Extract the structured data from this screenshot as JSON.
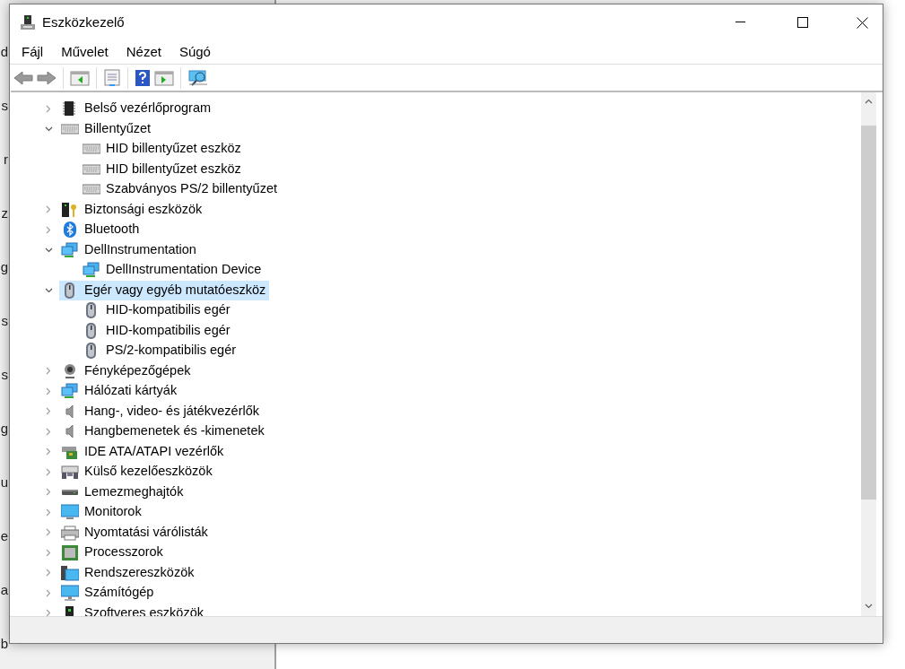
{
  "background_window": {
    "fragments": [
      "d",
      "s",
      "r",
      "z",
      "g",
      "s",
      "s",
      "g",
      "u",
      "e",
      "a",
      "b"
    ]
  },
  "window": {
    "title": "Eszközkezelő"
  },
  "menu": [
    "Fájl",
    "Művelet",
    "Nézet",
    "Súgó"
  ],
  "tree": [
    {
      "label": "Belső vezérlőprogram",
      "kind": "chip",
      "expanded": false,
      "selected": false
    },
    {
      "label": "Billentyűzet",
      "kind": "keyboard",
      "expanded": true,
      "selected": false,
      "children": [
        {
          "label": "HID billentyűzet eszköz",
          "kind": "keyboard",
          "selected": false
        },
        {
          "label": "HID billentyűzet eszköz",
          "kind": "keyboard",
          "selected": false
        },
        {
          "label": "Szabványos PS/2 billentyűzet",
          "kind": "keyboard",
          "selected": false
        }
      ]
    },
    {
      "label": "Biztonsági eszközök",
      "kind": "security",
      "expanded": false,
      "selected": false
    },
    {
      "label": "Bluetooth",
      "kind": "bluetooth",
      "expanded": false,
      "selected": false
    },
    {
      "label": "DellInstrumentation",
      "kind": "network",
      "expanded": true,
      "selected": false,
      "children": [
        {
          "label": "DellInstrumentation Device",
          "kind": "network",
          "selected": false
        }
      ]
    },
    {
      "label": "Egér vagy egyéb mutatóeszköz",
      "kind": "mouse",
      "expanded": true,
      "selected": true,
      "children": [
        {
          "label": "HID-kompatibilis egér",
          "kind": "mouse",
          "selected": false
        },
        {
          "label": "HID-kompatibilis egér",
          "kind": "mouse",
          "selected": false
        },
        {
          "label": "PS/2-kompatibilis egér",
          "kind": "mouse",
          "selected": false
        }
      ]
    },
    {
      "label": "Fényképezőgépek",
      "kind": "camera",
      "expanded": false,
      "selected": false
    },
    {
      "label": "Hálózati kártyák",
      "kind": "network",
      "expanded": false,
      "selected": false
    },
    {
      "label": "Hang-, video- és játékvezérlők",
      "kind": "speaker",
      "expanded": false,
      "selected": false
    },
    {
      "label": "Hangbemenetek és -kimenetek",
      "kind": "speaker",
      "expanded": false,
      "selected": false
    },
    {
      "label": "IDE ATA/ATAPI vezérlők",
      "kind": "controller",
      "expanded": false,
      "selected": false
    },
    {
      "label": "Külső kezelőeszközök",
      "kind": "hid",
      "expanded": false,
      "selected": false
    },
    {
      "label": "Lemezmeghajtók",
      "kind": "disk",
      "expanded": false,
      "selected": false
    },
    {
      "label": "Monitorok",
      "kind": "monitor",
      "expanded": false,
      "selected": false
    },
    {
      "label": "Nyomtatási várólisták",
      "kind": "printer",
      "expanded": false,
      "selected": false
    },
    {
      "label": "Processzorok",
      "kind": "cpu",
      "expanded": false,
      "selected": false
    },
    {
      "label": "Rendszereszközök",
      "kind": "system",
      "expanded": false,
      "selected": false
    },
    {
      "label": "Számítógép",
      "kind": "computer",
      "expanded": false,
      "selected": false
    },
    {
      "label": "Szoftveres eszközök",
      "kind": "software",
      "expanded": false,
      "selected": false
    }
  ]
}
